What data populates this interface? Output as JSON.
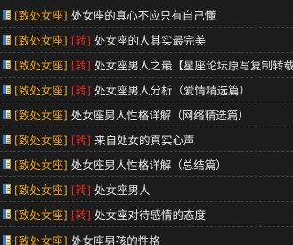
{
  "colors": {
    "background": "#1c1c1c",
    "category": "#e8a020",
    "tag": "#e02828",
    "title": "#e8e8e8"
  },
  "icon": "document-icon",
  "articles": [
    {
      "category": "[致处女座]",
      "tag": "",
      "title": "处女座的真心不应只有自己懂"
    },
    {
      "category": "[致处女座]",
      "tag": "[转]",
      "title": "处女座的人其实最完美"
    },
    {
      "category": "[致处女座]",
      "tag": "[转]",
      "title": "处女座男人之最【星座论坛原写复制转载】"
    },
    {
      "category": "[致处女座]",
      "tag": "[转]",
      "title": "处女座男人分析（爱情精选篇）"
    },
    {
      "category": "[致处女座]",
      "tag": "",
      "title": "处女座男人性格详解（网络精选篇）"
    },
    {
      "category": "[致处女座]",
      "tag": "[转]",
      "title": "来自处女的真实心声"
    },
    {
      "category": "[致处女座]",
      "tag": "",
      "title": "处女座男人性格详解（总结篇）"
    },
    {
      "category": "[致处女座]",
      "tag": "[转]",
      "title": "处女座男人"
    },
    {
      "category": "[致处女座]",
      "tag": "[转]",
      "title": "处女座对待感情的态度"
    },
    {
      "category": "[致处女座]",
      "tag": "",
      "title": "处女座男孩的性格"
    }
  ]
}
